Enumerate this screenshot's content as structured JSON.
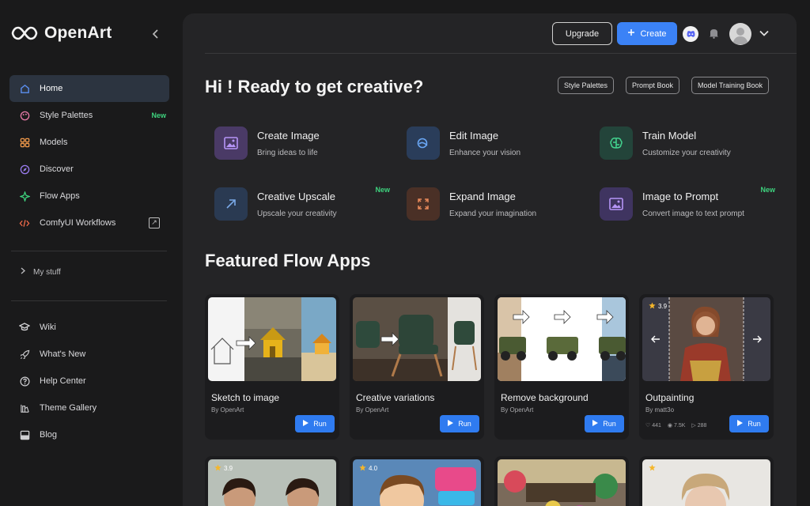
{
  "brand": {
    "name": "OpenArt"
  },
  "sidebar": {
    "collapse_icon": "chevron-left-icon",
    "items": [
      {
        "label": "Home",
        "icon": "home-icon",
        "active": true
      },
      {
        "label": "Style Palettes",
        "icon": "palette-icon",
        "badge": "New"
      },
      {
        "label": "Models",
        "icon": "grid-icon"
      },
      {
        "label": "Discover",
        "icon": "compass-icon"
      },
      {
        "label": "Flow Apps",
        "icon": "flow-icon"
      },
      {
        "label": "ComfyUI Workflows",
        "icon": "code-icon",
        "external": true
      }
    ],
    "my_stuff": "My stuff",
    "secondary": [
      {
        "label": "Wiki",
        "icon": "graduation-cap-icon"
      },
      {
        "label": "What's New",
        "icon": "rocket-icon"
      },
      {
        "label": "Help Center",
        "icon": "help-circle-icon"
      },
      {
        "label": "Theme Gallery",
        "icon": "gallery-icon"
      },
      {
        "label": "Blog",
        "icon": "blog-icon"
      }
    ]
  },
  "header": {
    "upgrade_label": "Upgrade",
    "create_label": "Create"
  },
  "hero": {
    "greeting": "Hi ! Ready to get creative?",
    "pills": [
      "Style Palettes",
      "Prompt Book",
      "Model Training Book"
    ]
  },
  "features": [
    {
      "title": "Create Image",
      "subtitle": "Bring ideas to life",
      "icon": "image-icon",
      "color": "#4a3a66",
      "icon_color": "#b695f7"
    },
    {
      "title": "Edit Image",
      "subtitle": "Enhance your vision",
      "icon": "edit-image-icon",
      "color": "#2a3d5a",
      "icon_color": "#6aa7f5"
    },
    {
      "title": "Train Model",
      "subtitle": "Customize your creativity",
      "icon": "brain-icon",
      "color": "#23443a",
      "icon_color": "#43d38f"
    },
    {
      "title": "Creative Upscale",
      "subtitle": "Upscale your creativity",
      "icon": "arrow-up-right-icon",
      "color": "#2a3a52",
      "icon_color": "#7aa9e8",
      "badge": "New"
    },
    {
      "title": "Expand Image",
      "subtitle": "Expand your imagination",
      "icon": "expand-icon",
      "color": "#4a3026",
      "icon_color": "#e8895a"
    },
    {
      "title": "Image to Prompt",
      "subtitle": "Convert image to text prompt",
      "icon": "image-icon",
      "color": "#3f3460",
      "icon_color": "#b695f7",
      "badge": "New"
    }
  ],
  "featured": {
    "title": "Featured Flow Apps",
    "cards": [
      {
        "title": "Sketch to image",
        "by": "By OpenArt",
        "run": "Run"
      },
      {
        "title": "Creative variations",
        "by": "By OpenArt",
        "run": "Run"
      },
      {
        "title": "Remove background",
        "by": "By OpenArt",
        "run": "Run"
      },
      {
        "title": "Outpainting",
        "by": "By matt3o",
        "run": "Run",
        "rating": "3.9",
        "likes": "441",
        "views": "7.5K",
        "shares": "288"
      }
    ],
    "row2_ratings": [
      "3.9",
      "4.0",
      "",
      ""
    ]
  }
}
